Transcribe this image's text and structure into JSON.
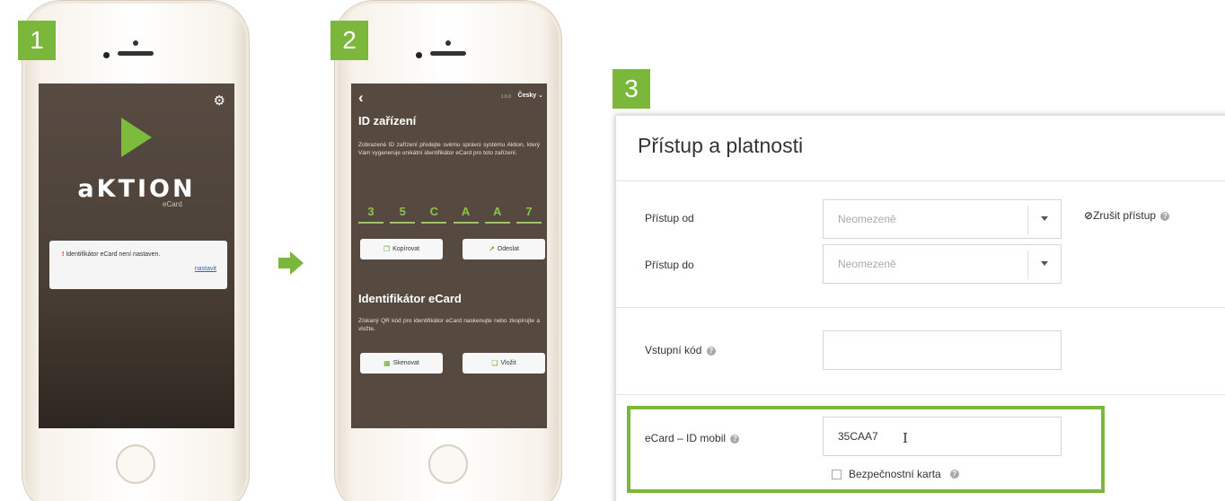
{
  "steps": [
    "1",
    "2",
    "3"
  ],
  "screen1": {
    "logo_text": "aKTION",
    "logo_sub": "eCard",
    "alert_text": "Identifikátor eCard není nastaven.",
    "alert_link": "nastavit"
  },
  "screen2": {
    "version": "1.6.0",
    "language": "Česky",
    "heading_device_id": "ID zařízení",
    "device_id_text": "Zobrazené ID zařízení předejte svému správci systému Aktion, který Vám vygeneruje unikátní identifikátor eCard pro toto zařízení.",
    "device_id_chars": [
      "3",
      "5",
      "C",
      "A",
      "A",
      "7"
    ],
    "copy_button": "Kopírovat",
    "send_button": "Odeslat",
    "heading_identifier": "Identifikátor eCard",
    "identifier_text": "Získaný QR kód pro identifikátor eCard naskenujte nebo zkopírujte a vložte.",
    "scan_button": "Skenovat",
    "paste_button": "Vložit"
  },
  "panel": {
    "title": "Přístup a platnosti",
    "access_from_label": "Přístup od",
    "access_from_value": "Neomezeně",
    "access_to_label": "Přístup do",
    "access_to_value": "Neomezeně",
    "revoke_label": "Zrušit přístup",
    "entry_code_label": "Vstupní kód",
    "entry_code_value": "",
    "ecard_label": "eCard – ID mobil",
    "ecard_value": "35CAA7",
    "security_card_label": "Bezpečnostní karta"
  },
  "colors": {
    "accent_green": "#7ab73a",
    "screen_brown": "#564a40"
  }
}
